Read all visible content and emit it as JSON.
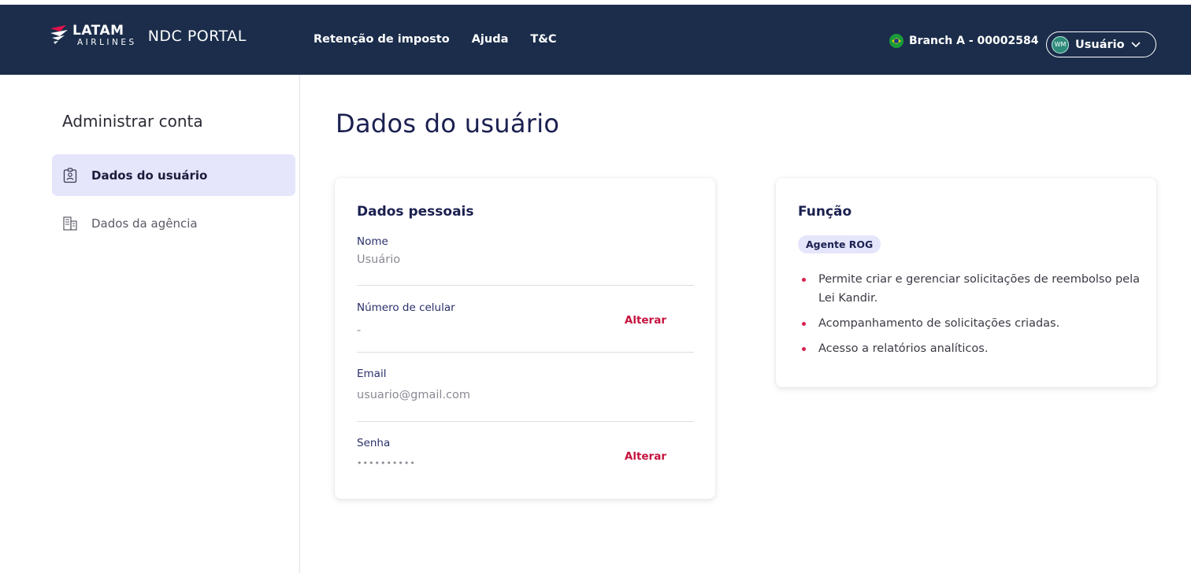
{
  "header": {
    "brand_primary": "LATAM",
    "brand_secondary": "AIRLINES",
    "portal_name": "NDC PORTAL",
    "nav": [
      {
        "label": "Retenção de imposto"
      },
      {
        "label": "Ajuda"
      },
      {
        "label": "T&C"
      }
    ],
    "branch_label": "Branch A - 00002584",
    "branch_flag_icon": "brazil-flag-icon",
    "user_initials": "WM",
    "user_label": "Usuário",
    "colors": {
      "bar": "#1b2d4b"
    }
  },
  "sidebar": {
    "title": "Administrar conta",
    "items": [
      {
        "label": "Dados do usuário",
        "icon": "user-badge-icon",
        "active": true
      },
      {
        "label": "Dados da agência",
        "icon": "building-icon",
        "active": false
      }
    ]
  },
  "main": {
    "title": "Dados do usuário",
    "personal": {
      "title": "Dados pessoais",
      "fields": [
        {
          "label": "Nome",
          "value": "Usuário"
        },
        {
          "label": "Número de celular",
          "value": "-",
          "action": "Alterar"
        },
        {
          "label": "Email",
          "value": "usuario@gmail.com"
        },
        {
          "label": "Senha",
          "value": "••••••••••",
          "action": "Alterar"
        }
      ]
    },
    "role": {
      "title": "Função",
      "badge": "Agente ROG",
      "items": [
        "Permite criar e gerenciar solicitações de reembolso pela Lei Kandir.",
        "Acompanhamento de solicitações criadas.",
        "Acesso a relatórios analíticos."
      ]
    },
    "colors": {
      "accent": "#c4143f",
      "heading": "#1b2050",
      "badge_bg": "#e5e5fb"
    }
  }
}
